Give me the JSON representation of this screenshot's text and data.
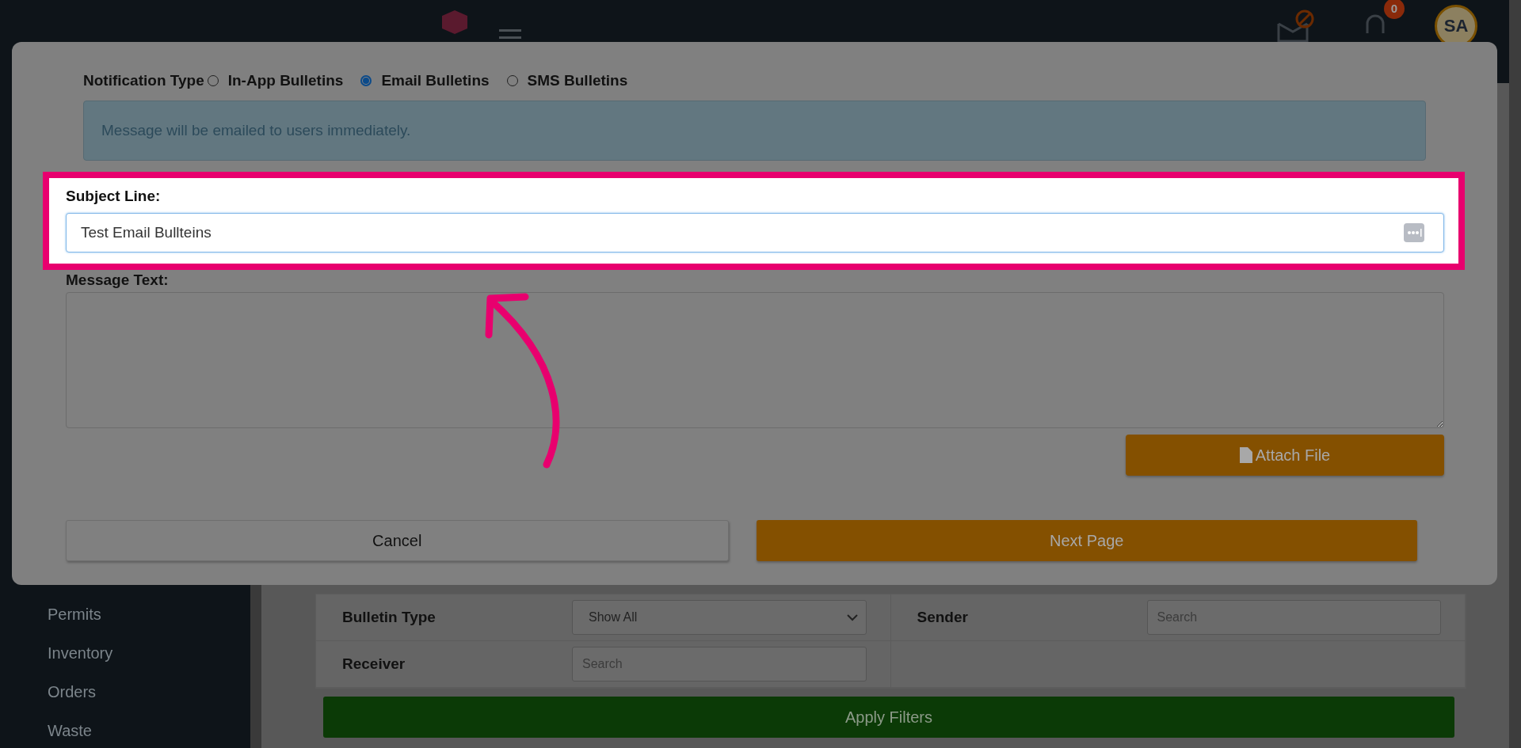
{
  "header": {
    "notification_badge": "0",
    "avatar_initials": "SA"
  },
  "sidebar": {
    "items": [
      "Permits",
      "Inventory",
      "Orders",
      "Waste"
    ]
  },
  "filters": {
    "fields": [
      {
        "label": "Bulletin Type",
        "kind": "select",
        "value": "Show All"
      },
      {
        "label": "Sender",
        "kind": "search",
        "placeholder": "Search"
      },
      {
        "label": "Receiver",
        "kind": "search",
        "placeholder": "Search"
      }
    ],
    "apply_button": "Apply Filters"
  },
  "modal": {
    "notification_type_label": "Notification Type",
    "options": [
      {
        "label": "In-App Bulletins",
        "selected": false
      },
      {
        "label": "Email Bulletins",
        "selected": true
      },
      {
        "label": "SMS Bulletins",
        "selected": false
      }
    ],
    "info_message": "Message will be emailed to users immediately.",
    "subject_label": "Subject Line:",
    "subject_value": "Test Email Bullteins",
    "message_label": "Message Text:",
    "attach_button": "Attach File",
    "cancel_button": "Cancel",
    "next_button": "Next Page"
  }
}
